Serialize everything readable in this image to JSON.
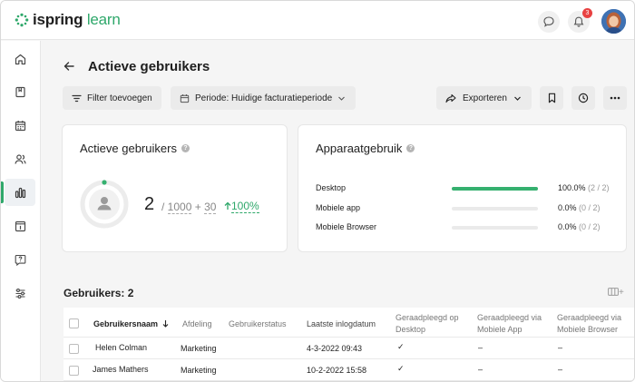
{
  "header": {
    "brand_strong": "ispring",
    "brand_light": "learn",
    "notifications_count": "3",
    "icons": [
      "chat-icon",
      "bell-icon",
      "avatar"
    ]
  },
  "sidebar": {
    "items": [
      {
        "icon": "home-icon",
        "active": false
      },
      {
        "icon": "book-icon",
        "active": false
      },
      {
        "icon": "calendar-icon",
        "active": false
      },
      {
        "icon": "users-icon",
        "active": false
      },
      {
        "icon": "reports-icon",
        "active": true
      },
      {
        "icon": "info-icon",
        "active": false
      },
      {
        "icon": "help-icon",
        "active": false
      },
      {
        "icon": "settings-sliders-icon",
        "active": false
      }
    ]
  },
  "page": {
    "title": "Actieve gebruikers"
  },
  "toolbar": {
    "filter_label": "Filter toevoegen",
    "period_label": "Periode: Huidige facturatieperiode",
    "export_label": "Exporteren"
  },
  "active_users_card": {
    "title": "Actieve gebruikers",
    "count": "2",
    "separator": " / ",
    "limit": "1000",
    "plus": " + ",
    "extra": "30",
    "trend": "100%"
  },
  "device_card": {
    "title": "Apparaatgebruik",
    "rows": [
      {
        "label": "Desktop",
        "fraction": 1.0,
        "percent": "100.0%",
        "of": "(2 / 2)"
      },
      {
        "label": "Mobiele app",
        "fraction": 0,
        "percent": "0.0%",
        "of": "(0 / 2)"
      },
      {
        "label": "Mobiele Browser",
        "fraction": 0,
        "percent": "0.0%",
        "of": "(0 / 2)"
      }
    ]
  },
  "users_section": {
    "title": "Gebruikers: 2",
    "columns_button": "+"
  },
  "table": {
    "headers": {
      "username": "Gebruikersnaam",
      "department": "Afdeling",
      "status": "Gebruikerstatus",
      "last_login": "Laatste inlogdatum",
      "desktop_1": "Geraadpleegd op",
      "desktop_2": "Desktop",
      "app_1": "Geraadpleegd via",
      "app_2": "Mobiele App",
      "browser_1": "Geraadpleegd via",
      "browser_2": "Mobiele Browser"
    },
    "rows": [
      {
        "name": "Helen Colman",
        "department": "Marketing",
        "status": "",
        "last_login": "4-3-2022 09:43",
        "desktop": "✓",
        "app": "–",
        "browser": "–"
      },
      {
        "name": "James Mathers",
        "department": "Marketing",
        "status": "",
        "last_login": "10-2-2022 15:58",
        "desktop": "✓",
        "app": "–",
        "browser": "–"
      }
    ]
  },
  "colors": {
    "accent": "#2fa86b",
    "badge": "#e84141"
  }
}
